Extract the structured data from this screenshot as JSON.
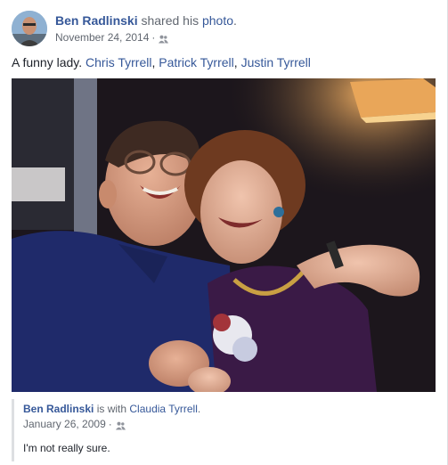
{
  "post": {
    "author": "Ben Radlinski",
    "action_text": "shared his",
    "object_link": "photo",
    "action_suffix": ".",
    "date": "November 24, 2014",
    "separator": "·",
    "audience_icon": "friends-icon",
    "caption_text": "A funny lady.",
    "tags": [
      {
        "name": "Chris Tyrrell",
        "after": ","
      },
      {
        "name": "Patrick Tyrrell",
        "after": ","
      },
      {
        "name": "Justin Tyrrell",
        "after": ""
      }
    ]
  },
  "original": {
    "author": "Ben Radlinski",
    "with_text": "is with",
    "with_name": "Claudia Tyrrell",
    "with_suffix": ".",
    "date": "January 26, 2009",
    "separator": "·",
    "audience_icon": "friends-icon",
    "caption": "I'm not really sure."
  },
  "colors": {
    "link": "#365899",
    "muted": "#616770",
    "text": "#1d2129",
    "quote_bar": "#dddfe2"
  }
}
